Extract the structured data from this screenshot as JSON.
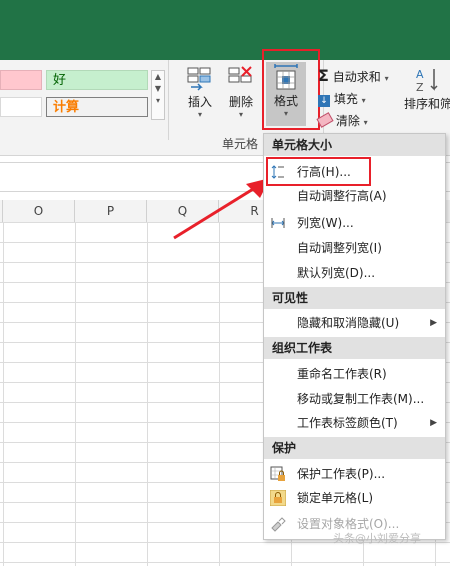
{
  "ribbon": {
    "styles": {
      "good": "好",
      "calculation": "计算"
    },
    "cells_group": {
      "label": "单元格",
      "insert": "插入",
      "delete": "删除",
      "format": "格式"
    },
    "editing": {
      "autosum": "自动求和",
      "fill": "填充",
      "clear": "清除",
      "sort_filter": "排序和筛"
    }
  },
  "columns": [
    "O",
    "P",
    "Q",
    "R"
  ],
  "format_menu": {
    "sections": {
      "cell_size": "单元格大小",
      "visibility": "可见性",
      "organize_sheets": "组织工作表",
      "protection": "保护"
    },
    "items": {
      "row_height": "行高(H)...",
      "autofit_row_height": "自动调整行高(A)",
      "column_width": "列宽(W)...",
      "autofit_column_width": "自动调整列宽(I)",
      "default_width": "默认列宽(D)...",
      "hide_unhide": "隐藏和取消隐藏(U)",
      "rename_sheet": "重命名工作表(R)",
      "move_copy_sheet": "移动或复制工作表(M)...",
      "tab_color": "工作表标签颜色(T)",
      "protect_sheet": "保护工作表(P)...",
      "lock_cell": "锁定单元格(L)",
      "format_cells": "设置对象格式(O)..."
    }
  },
  "watermark": "头条@小刘爱分享",
  "colors": {
    "title_bar": "#217346",
    "highlight": "#e8202a",
    "good_fill": "#c6efce",
    "calc_text": "#fa7d00"
  }
}
